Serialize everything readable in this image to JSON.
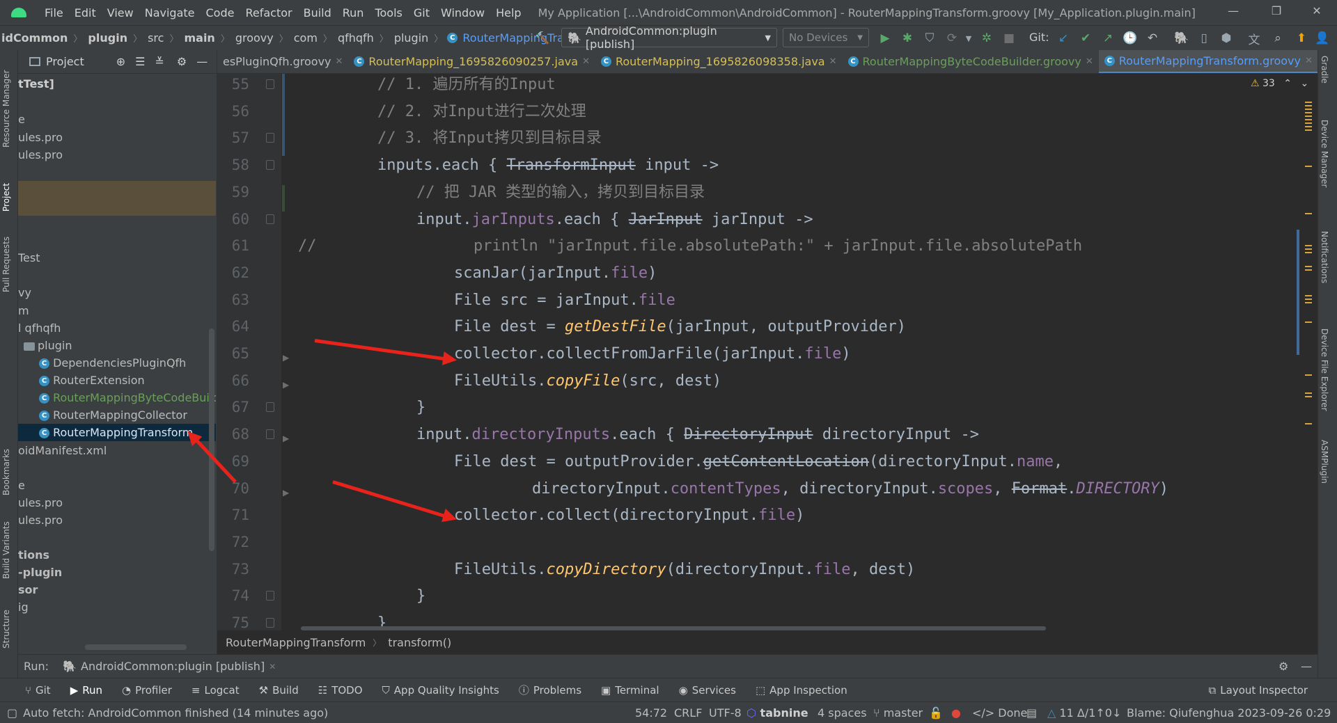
{
  "menu": [
    "File",
    "Edit",
    "View",
    "Navigate",
    "Code",
    "Refactor",
    "Build",
    "Run",
    "Tools",
    "Git",
    "Window",
    "Help"
  ],
  "window_title": "My Application [...\\AndroidCommon\\AndroidCommon] - RouterMappingTransform.groovy [My_Application.plugin.main]",
  "nav": {
    "items": [
      "idCommon",
      "plugin",
      "src",
      "main",
      "groovy",
      "com",
      "qfhqfh",
      "plugin"
    ],
    "file": "RouterMappingTransform",
    "run_config": "AndroidCommon:plugin [publish]",
    "devices": "No Devices",
    "git_label": "Git:"
  },
  "left_strip": [
    "Resource Manager",
    "Project",
    "Pull Requests",
    "Bookmarks",
    "Build Variants",
    "Structure"
  ],
  "right_strip": [
    "Gradle",
    "Device Manager",
    "Notifications",
    "Device File Explorer",
    "ASMPlugin"
  ],
  "project": {
    "title": "Project",
    "tree": [
      "tTest]",
      "e",
      "ules.pro",
      "ules.pro",
      "Test",
      "vy",
      "m",
      "l qfhqfh",
      "plugin",
      "DependenciesPluginQfh",
      "RouterExtension",
      "RouterMappingByteCodeBuilde",
      "RouterMappingCollector",
      "RouterMappingTransform",
      "oidManifest.xml",
      "e",
      "ules.pro",
      "ules.pro",
      "tions",
      "-plugin",
      "sor",
      "ig"
    ]
  },
  "tabs": [
    "esPluginQfh.groovy",
    "RouterMapping_1695826090257.java",
    "RouterMapping_1695826098358.java",
    "RouterMappingByteCodeBuilder.groovy",
    "RouterMappingTransform.groovy"
  ],
  "warnings": "33",
  "line_numbers": [
    "55",
    "56",
    "57",
    "58",
    "59",
    "60",
    "61",
    "62",
    "63",
    "64",
    "65",
    "66",
    "67",
    "68",
    "69",
    "70",
    "71",
    "72",
    "73",
    "74",
    "75"
  ],
  "code": {
    "l55": "// 1. 遍历所有的Input",
    "l56": "// 2. 对Input进行二次处理",
    "l57": "// 3. 将Input拷贝到目标目录",
    "l58a": "inputs.each { ",
    "l58b": "TransformInput",
    "l58c": " input ->",
    "l59": "// 把 JAR 类型的输入，拷贝到目标目录",
    "l60a": "input.",
    "l60b": "jarInputs",
    "l60c": ".each { ",
    "l60d": "JarInput",
    "l60e": " jarInput ->",
    "l61a": "//",
    "l61b": "println \"jarInput.file.absolutePath:\" + jarInput.file.absolutePath",
    "l62a": "scanJar(jarInput.",
    "l62b": "file",
    "l62c": ")",
    "l63a": "File src = jarInput.",
    "l63b": "file",
    "l64a": "File dest = ",
    "l64b": "getDestFile",
    "l64c": "(jarInput, outputProvider)",
    "l65a": "collector.collectFromJarFile(jarInput.",
    "l65b": "file",
    "l65c": ")",
    "l66a": "FileUtils.",
    "l66b": "copyFile",
    "l66c": "(src, dest)",
    "l67": "}",
    "l68a": "input.",
    "l68b": "directoryInputs",
    "l68c": ".each { ",
    "l68d": "DirectoryInput",
    "l68e": " directoryInput ->",
    "l69a": "File dest = outputProvider.",
    "l69b": "getContentLocation",
    "l69c": "(directoryInput.",
    "l69d": "name",
    "l69e": ",",
    "l70a": "directoryInput.",
    "l70b": "contentTypes",
    "l70c": ", directoryInput.",
    "l70d": "scopes",
    "l70e": ", ",
    "l70f": "Format",
    "l70g": ".",
    "l70h": "DIRECTORY",
    "l70i": ")",
    "l71a": "collector.collect(directoryInput.",
    "l71b": "file",
    "l71c": ")",
    "l73a": "FileUtils.",
    "l73b": "copyDirectory",
    "l73c": "(directoryInput.",
    "l73d": "file",
    "l73e": ", dest)",
    "l74": "}",
    "l75": "}"
  },
  "breadcrumb": [
    "RouterMappingTransform",
    "transform()"
  ],
  "run": {
    "label": "Run:",
    "config": "AndroidCommon:plugin [publish]"
  },
  "tool_windows": [
    "Git",
    "Run",
    "Profiler",
    "Logcat",
    "Build",
    "TODO",
    "App Quality Insights",
    "Problems",
    "Terminal",
    "Services",
    "App Inspection"
  ],
  "layout_inspector": "Layout Inspector",
  "status": {
    "message": "Auto fetch: AndroidCommon finished (14 minutes ago)",
    "position": "54:72",
    "line_sep": "CRLF",
    "encoding": "UTF-8",
    "tabnine": "tabnine",
    "indent": "4 spaces",
    "branch": "master",
    "done": "Done",
    "changes": "11 Δ/1↑0↓",
    "blame": "Blame: Qiufenghua 2023-09-26 0:29"
  },
  "colors": {
    "accent": "#4a88c7",
    "arrow": "#e8231b",
    "selected_row": "#0d293e",
    "highlight_row": "#5a4f3a"
  }
}
